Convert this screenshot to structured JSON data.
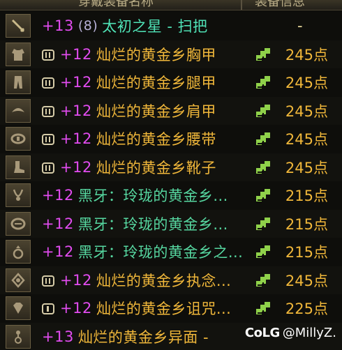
{
  "header": {
    "name_column": "穿戴装备名称",
    "info_column": "装备信息"
  },
  "rows": [
    {
      "icon": "weapon-icon",
      "plus": "+13",
      "sub": "(8)",
      "name": "太初之星 - 扫把",
      "name_color": "cyan",
      "badge": "",
      "points": "",
      "dash": "-"
    },
    {
      "icon": "chest-armor-icon",
      "plus": "+12",
      "sub": "",
      "name": "灿烂的黄金乡胸甲",
      "name_color": "gold",
      "badge": "triple",
      "points": "245点",
      "dash": ""
    },
    {
      "icon": "legs-armor-icon",
      "plus": "+12",
      "sub": "",
      "name": "灿烂的黄金乡腿甲",
      "name_color": "gold",
      "badge": "triple",
      "points": "245点",
      "dash": ""
    },
    {
      "icon": "shoulder-armor-icon",
      "plus": "+12",
      "sub": "",
      "name": "灿烂的黄金乡肩甲",
      "name_color": "gold",
      "badge": "triple",
      "points": "245点",
      "dash": ""
    },
    {
      "icon": "belt-icon",
      "plus": "+12",
      "sub": "",
      "name": "灿烂的黄金乡腰带",
      "name_color": "gold",
      "badge": "triple",
      "points": "245点",
      "dash": ""
    },
    {
      "icon": "boots-icon",
      "plus": "+12",
      "sub": "",
      "name": "灿烂的黄金乡靴子",
      "name_color": "gold",
      "badge": "triple",
      "points": "245点",
      "dash": ""
    },
    {
      "icon": "necklace-icon",
      "plus": "+12",
      "sub": "",
      "name": "黑牙：玲珑的黄金乡...",
      "name_color": "green",
      "badge": "",
      "points": "215点",
      "dash": ""
    },
    {
      "icon": "bracelet-icon",
      "plus": "+12",
      "sub": "",
      "name": "黑牙：玲珑的黄金乡...",
      "name_color": "green",
      "badge": "",
      "points": "215点",
      "dash": ""
    },
    {
      "icon": "ring-icon",
      "plus": "+12",
      "sub": "",
      "name": "黑牙：玲珑的黄金乡之...",
      "name_color": "green",
      "badge": "",
      "points": "215点",
      "dash": ""
    },
    {
      "icon": "sub-equipment-icon",
      "plus": "+12",
      "sub": "",
      "name": "灿烂的黄金乡执念...",
      "name_color": "gold",
      "badge": "triple",
      "points": "245点",
      "dash": ""
    },
    {
      "icon": "magic-stone-icon",
      "plus": "+12",
      "sub": "",
      "name": "灿烂的黄金乡诅咒...",
      "name_color": "gold",
      "badge": "single",
      "points": "225点",
      "dash": ""
    },
    {
      "icon": "earring-icon",
      "plus": "+13",
      "sub": "",
      "name": "灿烂的黄金乡异面 -",
      "name_color": "gold",
      "badge": "",
      "points": "",
      "dash": ""
    }
  ],
  "watermark": {
    "logo": "CoLG",
    "handle": "@MillyZ."
  },
  "colors": {
    "gold": "#f0b73a",
    "green": "#56d7a0",
    "plus": "#e24cf0",
    "stat_icon": "#8fd14a"
  }
}
